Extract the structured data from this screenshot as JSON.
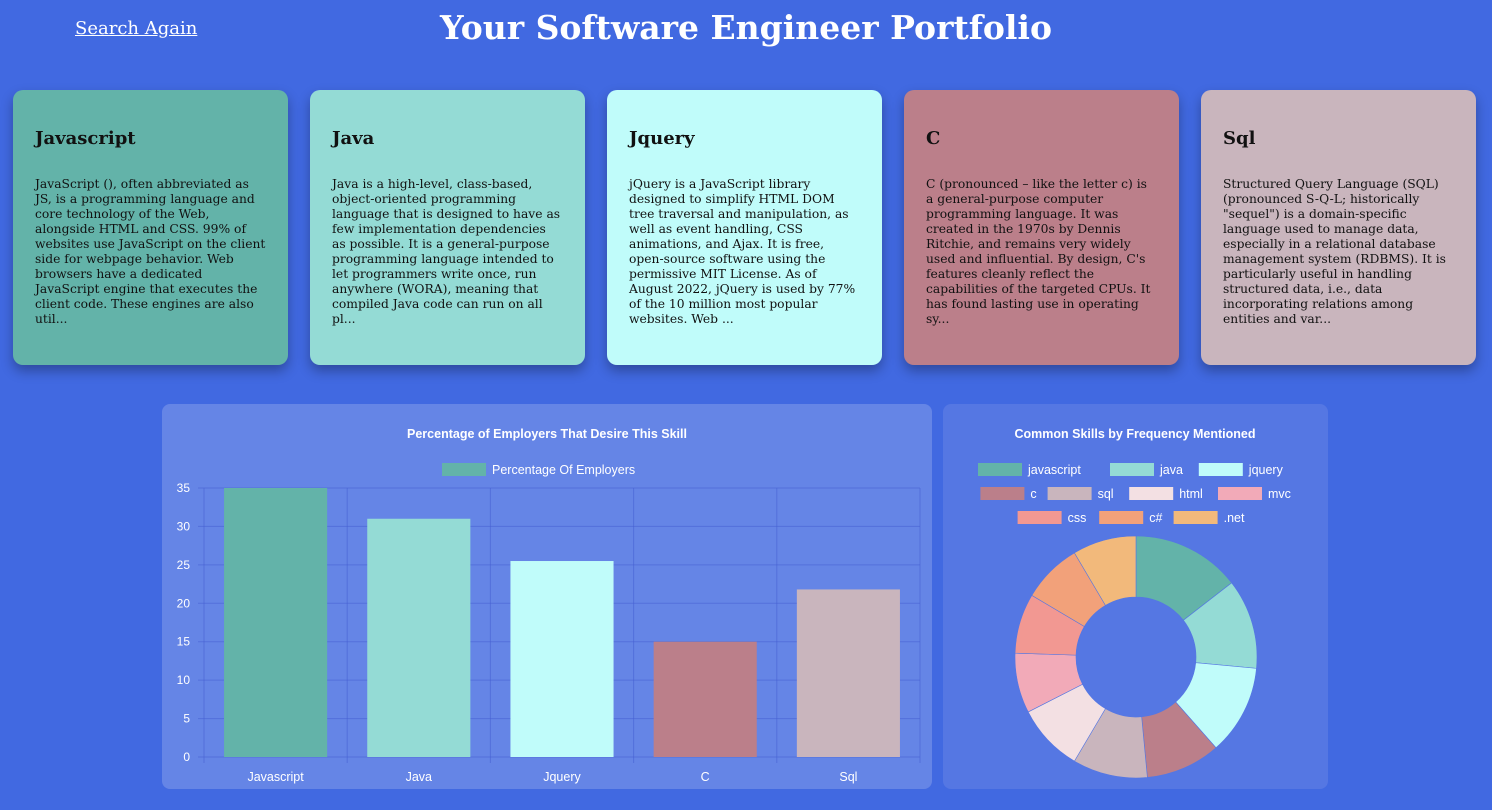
{
  "header": {
    "search_again_label": "Search Again",
    "title": "Your Software Engineer Portfolio"
  },
  "cards": [
    {
      "title": "Javascript",
      "color": "#63b3a9",
      "text": "JavaScript (), often abbreviated as JS, is a programming language and core technology of the Web, alongside HTML and CSS. 99% of websites use JavaScript on the client side for webpage behavior. Web browsers have a dedicated JavaScript engine that executes the client code. These engines are also util..."
    },
    {
      "title": "Java",
      "color": "#94dbd5",
      "text": "Java is a high-level, class-based, object-oriented programming language that is designed to have as few implementation dependencies as possible. It is a general-purpose programming language intended to let programmers write once, run anywhere (WORA), meaning that compiled Java code can run on all pl..."
    },
    {
      "title": "Jquery",
      "color": "#c0fcfa",
      "text": "jQuery is a JavaScript library designed to simplify HTML DOM tree traversal and manipulation, as well as event handling, CSS animations, and Ajax. It is free, open-source software using the permissive MIT License. As of August 2022, jQuery is used by 77% of the 10 million most popular websites. Web ..."
    },
    {
      "title": "C",
      "color": "#bb7f8a",
      "text": "C (pronounced – like the letter c) is a general-purpose computer programming language. It was created in the 1970s by Dennis Ritchie, and remains very widely used and influential. By design, C's features cleanly reflect the capabilities of the targeted CPUs. It has found lasting use in operating sy..."
    },
    {
      "title": "Sql",
      "color": "#c9b5bd",
      "text": "Structured Query Language (SQL) (pronounced S-Q-L; historically \"sequel\") is a domain-specific language used to manage data, especially in a relational database management system (RDBMS). It is particularly useful in handling structured data, i.e., data incorporating relations among entities and var..."
    }
  ],
  "chart_data": [
    {
      "type": "bar",
      "title": "Percentage of Employers That Desire This Skill",
      "categories": [
        "Javascript",
        "Java",
        "Jquery",
        "C",
        "Sql"
      ],
      "series": [
        {
          "name": "Percentage Of Employers",
          "values": [
            35,
            31,
            25.5,
            15,
            21.8
          ]
        }
      ],
      "colors": [
        "#63b3a9",
        "#94dbd5",
        "#c0fcfa",
        "#bb7f8a",
        "#c9b5bd"
      ],
      "legend_color": "#63b3a9",
      "ylim": [
        0,
        35
      ],
      "yticks": [
        0,
        5,
        10,
        15,
        20,
        25,
        30,
        35
      ],
      "grid": true,
      "legend": "top"
    },
    {
      "type": "pie",
      "title": "Common Skills by Frequency Mentioned",
      "labels": [
        "javascript",
        "java",
        "jquery",
        "c",
        "sql",
        "html",
        "mvc",
        "css",
        "c#",
        ".net"
      ],
      "values": [
        14.5,
        12,
        12,
        10,
        10,
        9,
        8,
        8,
        8,
        8.5
      ],
      "colors": [
        "#63b3a9",
        "#94dbd5",
        "#c0fcfa",
        "#bb7f8a",
        "#c9b5bd",
        "#f3e0e3",
        "#f2aab8",
        "#f29892",
        "#f2a17a",
        "#f2b97b"
      ],
      "legend": "top"
    }
  ]
}
